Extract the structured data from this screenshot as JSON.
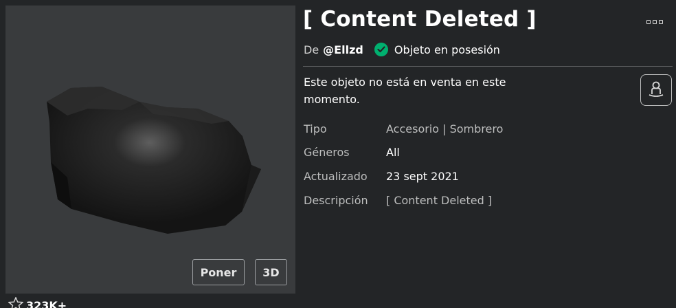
{
  "item": {
    "title": "[ Content Deleted ]",
    "by_prefix": "De",
    "creator": "@Ellzd",
    "owned_text": "Objeto en posesión",
    "offsale_text": "Este objeto no está en venta en este momento."
  },
  "details": {
    "type_label": "Tipo",
    "type_value": "Accesorio | Sombrero",
    "genres_label": "Géneros",
    "genres_value": "All",
    "updated_label": "Actualizado",
    "updated_value": "23 sept 2021",
    "description_label": "Descripción",
    "description_value": "[ Content Deleted ]"
  },
  "preview": {
    "try_on_label": "Poner",
    "three_d_label": "3D"
  },
  "favorites": {
    "count": "323K+"
  },
  "icons": {
    "menu": "more-options-icon",
    "verified": "check-circle-icon",
    "avatar": "avatar-try-on-icon",
    "favorite": "star-outline-icon"
  },
  "colors": {
    "background": "#232527",
    "preview_bg": "#393b3d",
    "owned_green": "#00b06f"
  }
}
